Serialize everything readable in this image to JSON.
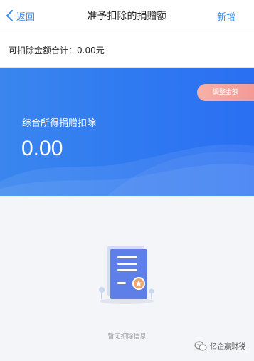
{
  "nav": {
    "back_label": "返回",
    "title": "准予扣除的捐赠额",
    "add_label": "新增"
  },
  "summary": {
    "label": "可扣除金额合计：0.00元"
  },
  "banner": {
    "adjust_label": "调整金额",
    "category_label": "综合所得捐赠扣除",
    "amount": "0.00"
  },
  "empty_state": {
    "message": "暂无扣除信息"
  },
  "watermark": {
    "text": "亿企赢财税"
  },
  "colors": {
    "accent": "#3c8cf0",
    "banner_start": "#3a86ee",
    "banner_end": "#2a6ff3",
    "adjust_button": "#f39a95",
    "empty_bg": "#f4f5f8"
  }
}
